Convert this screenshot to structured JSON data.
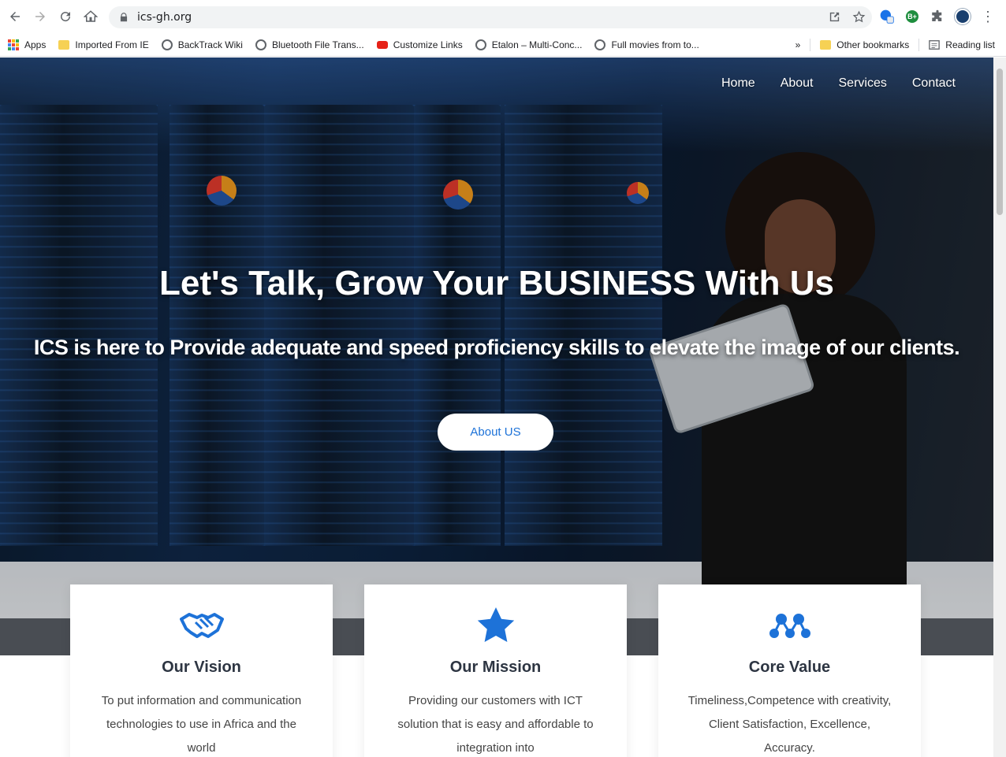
{
  "browser": {
    "url": "ics-gh.org",
    "bookmarks": [
      {
        "label": "Apps",
        "icon": "apps-grid-icon"
      },
      {
        "label": "Imported From IE",
        "icon": "folder-icon"
      },
      {
        "label": "BackTrack Wiki",
        "icon": "globe-icon"
      },
      {
        "label": "Bluetooth File Trans...",
        "icon": "globe-icon"
      },
      {
        "label": "Customize Links",
        "icon": "youtube-icon"
      },
      {
        "label": "Etalon – Multi-Conc...",
        "icon": "globe-icon"
      },
      {
        "label": "Full movies from to...",
        "icon": "globe-icon"
      }
    ],
    "overflow_label": "»",
    "other_bookmarks": "Other bookmarks",
    "reading_list": "Reading list",
    "extension_badge": "B+"
  },
  "nav": {
    "items": [
      "Home",
      "About",
      "Services",
      "Contact"
    ]
  },
  "hero": {
    "title": "Let's Talk, Grow Your BUSINESS With Us",
    "subtitle": "ICS is here to Provide adequate and speed proficiency skills to elevate the image of our clients.",
    "button": "About US"
  },
  "cards": [
    {
      "title": "Our Vision",
      "icon": "handshake-icon",
      "text": "To put information and communication technologies to use in Africa and the world"
    },
    {
      "title": "Our Mission",
      "icon": "star-icon",
      "text": "Providing our customers with ICT solution that is easy and affordable to integration into"
    },
    {
      "title": "Core Value",
      "icon": "network-icon",
      "text": "Timeliness,Competence with creativity, Client Satisfaction, Excellence, Accuracy."
    }
  ],
  "colors": {
    "accent": "#1d72d8",
    "heading": "#2d3542"
  }
}
